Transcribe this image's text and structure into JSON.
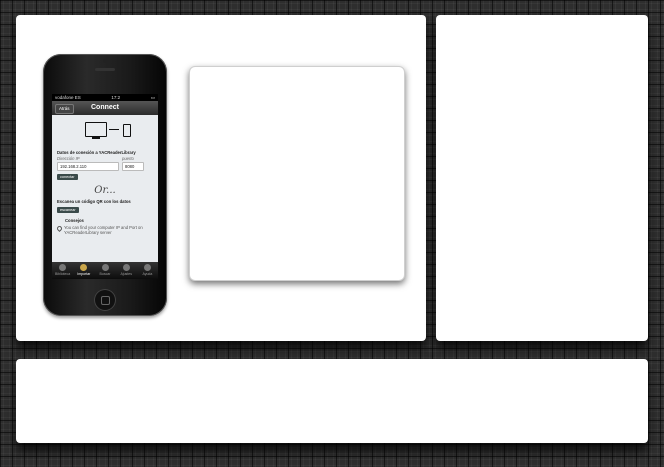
{
  "phone": {
    "status": {
      "carrier": "vodafone ES",
      "time": "17:2"
    },
    "nav": {
      "back_label": "Atrás",
      "title": "Connect"
    },
    "connection": {
      "heading": "Datos de conexión a YACReaderLibrary",
      "ip_label": "Dirección IP",
      "port_label": "puerto",
      "ip_value": "192.168.2.110",
      "port_value": "8080",
      "connect_button": "conectar"
    },
    "or_text": "Or...",
    "qr": {
      "heading": "Escanea un código QR con los datos",
      "scan_button": "escanear"
    },
    "tips": {
      "title": "Consejos",
      "text": "You can find your computer IP and Port on YACReaderLibrary server"
    },
    "tabs": [
      {
        "label": "Biblioteca",
        "active": false
      },
      {
        "label": "Importar",
        "active": true
      },
      {
        "label": "Buscar",
        "active": false
      },
      {
        "label": "Ajustes",
        "active": false
      },
      {
        "label": "Ayuda",
        "active": false
      }
    ]
  }
}
